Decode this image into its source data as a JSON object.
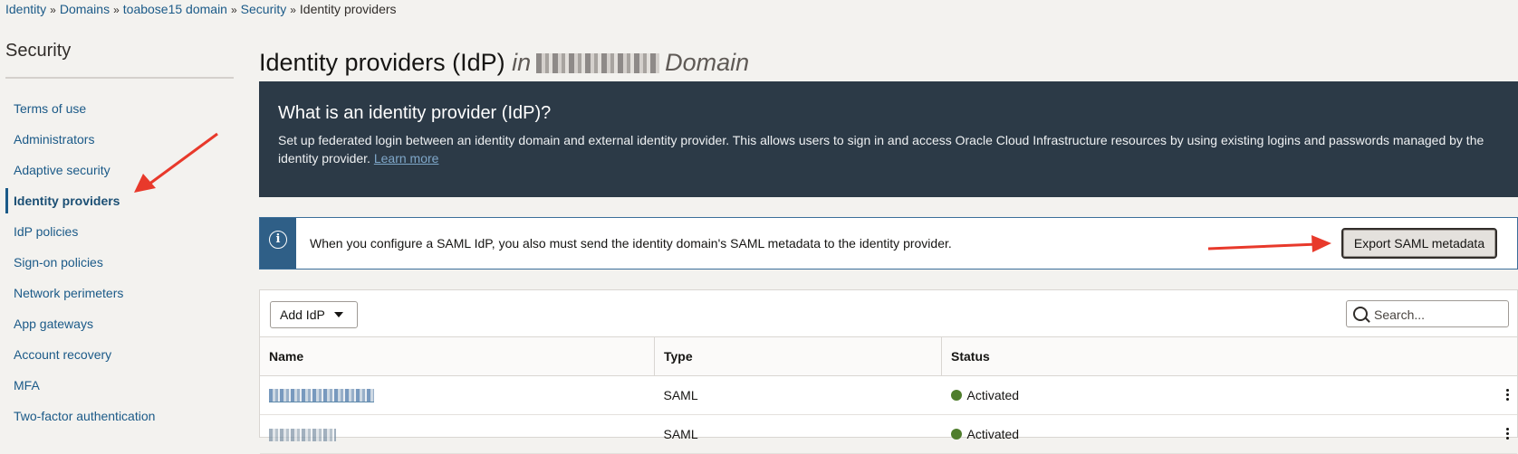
{
  "breadcrumb": {
    "items": [
      "Identity",
      "Domains",
      "toabose15 domain",
      "Security"
    ],
    "current": "Identity providers",
    "separator": "»"
  },
  "sidebar": {
    "title": "Security",
    "items": [
      {
        "label": "Terms of use"
      },
      {
        "label": "Administrators"
      },
      {
        "label": "Adaptive security"
      },
      {
        "label": "Identity providers",
        "active": true
      },
      {
        "label": "IdP policies"
      },
      {
        "label": "Sign-on policies"
      },
      {
        "label": "Network perimeters"
      },
      {
        "label": "App gateways"
      },
      {
        "label": "Account recovery"
      },
      {
        "label": "MFA"
      },
      {
        "label": "Two-factor authentication"
      }
    ]
  },
  "page": {
    "title": "Identity providers (IdP)",
    "title_in": "in",
    "title_domain": "Domain"
  },
  "info_panel": {
    "heading": "What is an identity provider (IdP)?",
    "body": "Set up federated login between an identity domain and external identity provider. This allows users to sign in and access Oracle Cloud Infrastructure resources by using existing logins and passwords managed by the identity provider.",
    "link": "Learn more"
  },
  "notice": {
    "icon": "info-icon",
    "text": "When you configure a SAML IdP, you also must send the identity domain's SAML metadata to the identity provider.",
    "button": "Export SAML metadata"
  },
  "table": {
    "add_button": "Add IdP",
    "search_placeholder": "Search...",
    "columns": [
      "Name",
      "Type",
      "Status"
    ],
    "rows": [
      {
        "type": "SAML",
        "status": "Activated"
      },
      {
        "type": "SAML",
        "status": "Activated"
      }
    ]
  },
  "colors": {
    "status_activated": "#4f7d2c",
    "annotation_arrow": "#e8392b"
  }
}
